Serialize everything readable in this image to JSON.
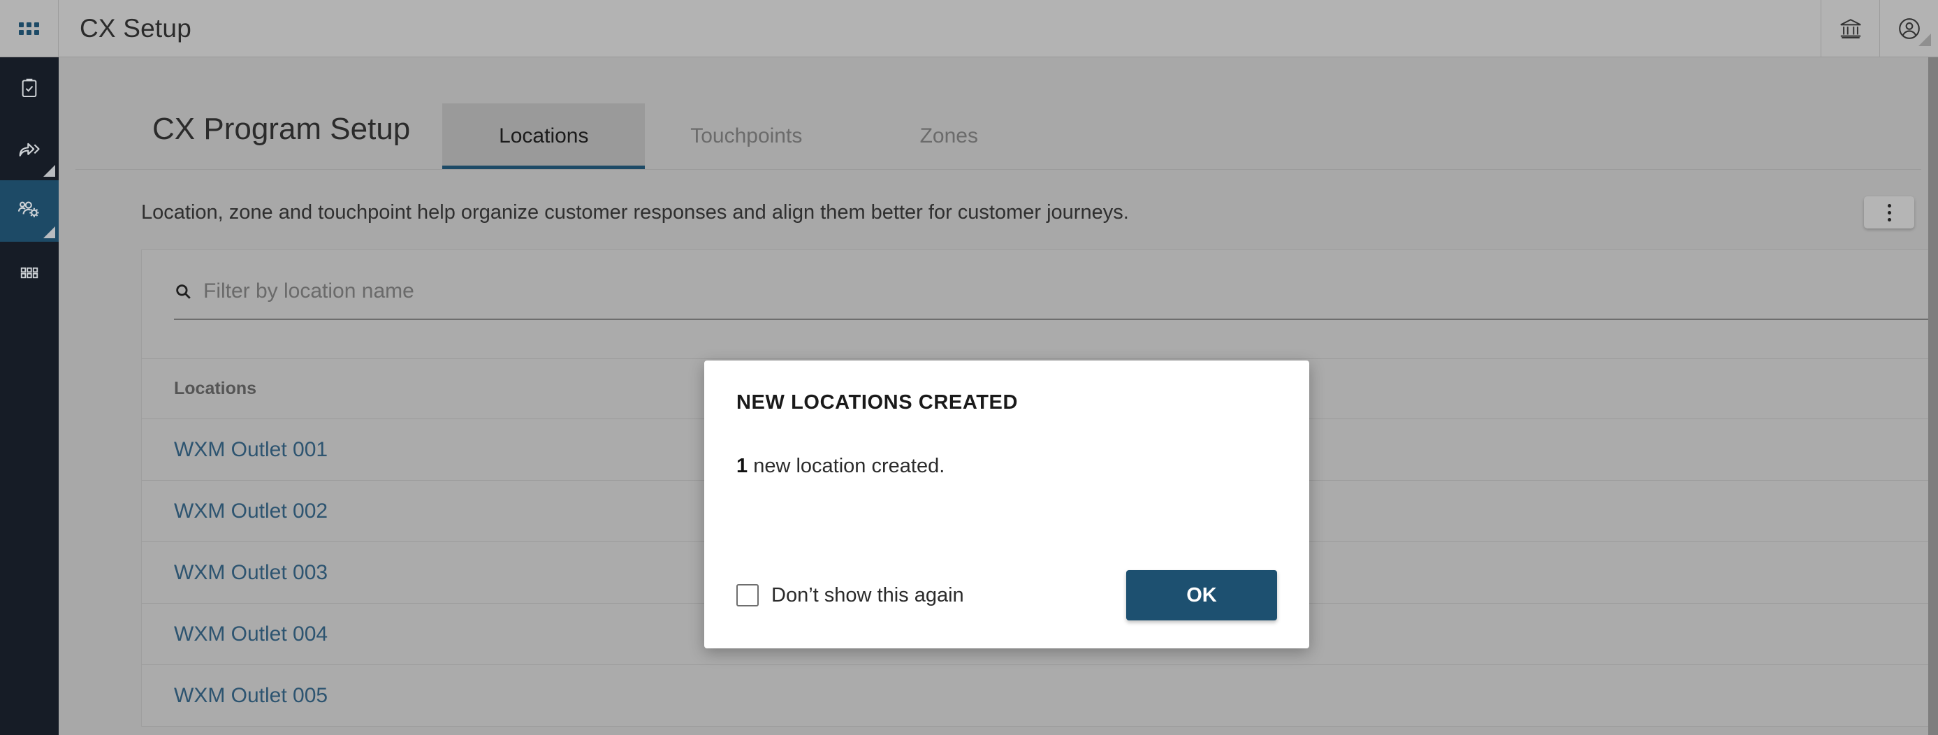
{
  "topbar": {
    "apps_icon": "grid-apps-icon",
    "title": "CX Setup",
    "org_icon": "bank-building-icon",
    "account_icon": "user-account-icon"
  },
  "sidebar": {
    "items": [
      {
        "icon": "clipboard-check-icon",
        "active": false,
        "has_corner": false
      },
      {
        "icon": "share-forward-icon",
        "active": false,
        "has_corner": true
      },
      {
        "icon": "people-gear-icon",
        "active": true,
        "has_corner": true
      },
      {
        "icon": "grid-apps-icon",
        "active": false,
        "has_corner": false
      }
    ]
  },
  "page": {
    "title": "CX Program Setup",
    "tabs": [
      {
        "label": "Locations",
        "active": true
      },
      {
        "label": "Touchpoints",
        "active": false
      },
      {
        "label": "Zones",
        "active": false
      }
    ],
    "description": "Location, zone and touchpoint help organize customer responses and align them better for customer journeys.",
    "kebab_menu_label": "more-options"
  },
  "search": {
    "icon": "search-icon",
    "placeholder": "Filter by location name",
    "value": ""
  },
  "table": {
    "column_header": "Locations",
    "rows": [
      {
        "name": "WXM Outlet 001"
      },
      {
        "name": "WXM Outlet 002"
      },
      {
        "name": "WXM Outlet 003"
      },
      {
        "name": "WXM Outlet 004"
      },
      {
        "name": "WXM Outlet 005"
      }
    ]
  },
  "modal": {
    "title": "NEW LOCATIONS CREATED",
    "count": "1",
    "message": " new location created.",
    "checkbox_label": "Don’t show this again",
    "checkbox_checked": false,
    "ok_label": "OK"
  },
  "colors": {
    "accent_blue": "#1d5070",
    "sidebar_bg": "#161c26",
    "sidebar_active": "#1d4a66",
    "page_bg": "#a8a8a8",
    "link_blue": "#2d5470"
  }
}
